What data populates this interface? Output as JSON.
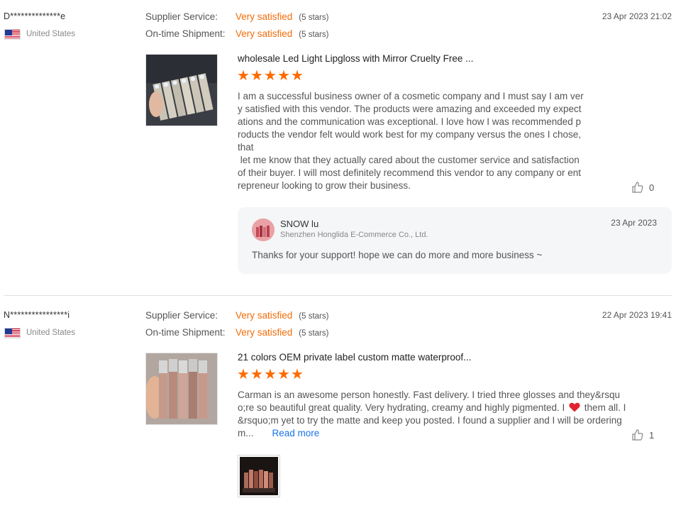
{
  "reviews": [
    {
      "buyer": "D**************e",
      "country": "United States",
      "supplier_service_label": "Supplier Service:",
      "supplier_service_value": "Very satisfied",
      "supplier_service_stars": "(5 stars)",
      "shipment_label": "On-time Shipment:",
      "shipment_value": "Very satisfied",
      "shipment_stars": "(5 stars)",
      "date": "23 Apr 2023 21:02",
      "product_title": "wholesale Led Light Lipgloss with Mirror Cruelty Free ...",
      "rating": 5,
      "text": "I am a successful business owner of a cosmetic company and I must say I am ver\ny satisfied with this vendor. The products were amazing and exceeded my expect\nations and the communication was exceptional. I love how I was recommended p\nroducts the vendor felt would work best for my company versus the ones I chose,\nthat\n let me know that they actually cared about the customer service and satisfaction\nof their buyer. I will most definitely recommend this vendor to any company or ent\nrepreneur looking to grow their business.",
      "likes": "0",
      "reply": {
        "name": "SNOW lu",
        "company": "Shenzhen Honglida E-Commerce Co., Ltd.",
        "date": "23 Apr 2023",
        "text": "Thanks for your support! hope we can do more and more business ~"
      }
    },
    {
      "buyer": "N****************i",
      "country": "United States",
      "supplier_service_label": "Supplier Service:",
      "supplier_service_value": "Very satisfied",
      "supplier_service_stars": "(5 stars)",
      "shipment_label": "On-time Shipment:",
      "shipment_value": "Very satisfied",
      "shipment_stars": "(5 stars)",
      "date": "22 Apr 2023 19:41",
      "product_title": "21 colors OEM private label custom matte waterproof...",
      "rating": 5,
      "text_line1": "Carman is an awesome person honestly. Fast delivery.  I tried three glosses and they&rsqu",
      "text_line2a": "o;re so beautiful great quality. Very hydrating, creamy and highly pigmented. I",
      "text_line2b": "them all. I",
      "text_line3": "&rsquo;m yet to try the matte  and keep you posted. I found a supplier and I will be ordering",
      "text_line4": "m...",
      "read_more": "Read more",
      "likes": "1"
    }
  ],
  "colors": {
    "accent": "#f36c08",
    "star": "#ff6a00",
    "link": "#1a73e8",
    "heart": "#e0232e"
  },
  "icons": [
    "us-flag-icon",
    "star-icon",
    "thumbs-up-icon",
    "heart-icon"
  ]
}
